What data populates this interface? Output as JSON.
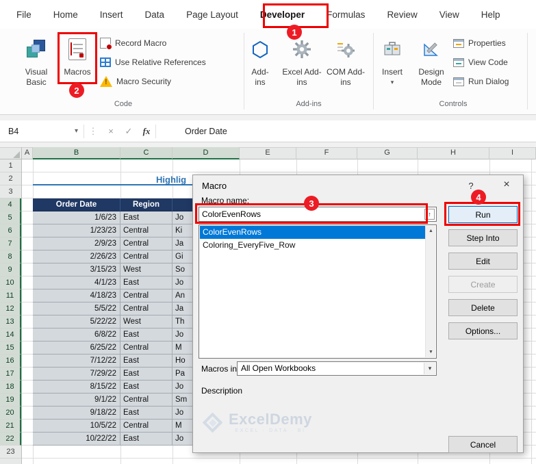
{
  "ribbon": {
    "tabs": [
      "File",
      "Home",
      "Insert",
      "Data",
      "Page Layout",
      "Developer",
      "Formulas",
      "Review",
      "View",
      "Help"
    ],
    "active_tab": "Developer",
    "code_group": {
      "label": "Code",
      "visual_basic": "Visual Basic",
      "macros": "Macros",
      "record_macro": "Record Macro",
      "use_relative_references": "Use Relative References",
      "macro_security": "Macro Security"
    },
    "addins_group": {
      "label": "Add-ins",
      "add_ins": "Add-ins",
      "excel_add_ins": "Excel Add-ins",
      "com_add_ins": "COM Add-ins"
    },
    "controls_group": {
      "label": "Controls",
      "insert": "Insert",
      "design_mode": "Design Mode",
      "properties": "Properties",
      "view_code": "View Code",
      "run_dialog": "Run Dialog"
    }
  },
  "formula_bar": {
    "name_box": "B4",
    "formula": "Order Date"
  },
  "annotations": {
    "step1": "1",
    "step2": "2",
    "step3": "3",
    "step4": "4"
  },
  "sheet": {
    "columns": [
      "A",
      "B",
      "C",
      "D",
      "E",
      "F",
      "G",
      "H",
      "I"
    ],
    "row_numbers": [
      "1",
      "2",
      "3",
      "4",
      "5",
      "6",
      "7",
      "8",
      "9",
      "10",
      "11",
      "12",
      "13",
      "14",
      "15",
      "16",
      "17",
      "18",
      "19",
      "20",
      "21",
      "22",
      "23"
    ],
    "title_visible": "Highlig",
    "table": {
      "header_order_date": "Order Date",
      "header_region": "Region",
      "rows": [
        {
          "date": "1/6/23",
          "region": "East",
          "person": "Jo"
        },
        {
          "date": "1/23/23",
          "region": "Central",
          "person": "Ki"
        },
        {
          "date": "2/9/23",
          "region": "Central",
          "person": "Ja"
        },
        {
          "date": "2/26/23",
          "region": "Central",
          "person": "Gi"
        },
        {
          "date": "3/15/23",
          "region": "West",
          "person": "So"
        },
        {
          "date": "4/1/23",
          "region": "East",
          "person": "Jo"
        },
        {
          "date": "4/18/23",
          "region": "Central",
          "person": "An"
        },
        {
          "date": "5/5/22",
          "region": "Central",
          "person": "Ja"
        },
        {
          "date": "5/22/22",
          "region": "West",
          "person": "Th"
        },
        {
          "date": "6/8/22",
          "region": "East",
          "person": "Jo"
        },
        {
          "date": "6/25/22",
          "region": "Central",
          "person": "M"
        },
        {
          "date": "7/12/22",
          "region": "East",
          "person": "Ho"
        },
        {
          "date": "7/29/22",
          "region": "East",
          "person": "Pa"
        },
        {
          "date": "8/15/22",
          "region": "East",
          "person": "Jo"
        },
        {
          "date": "9/1/22",
          "region": "Central",
          "person": "Sm"
        },
        {
          "date": "9/18/22",
          "region": "East",
          "person": "Jo"
        },
        {
          "date": "10/5/22",
          "region": "Central",
          "person": "M"
        },
        {
          "date": "10/22/22",
          "region": "East",
          "person": "Jo"
        }
      ]
    }
  },
  "dialog": {
    "title": "Macro",
    "macro_name_label": "Macro name:",
    "macro_name_value": "ColorEvenRows",
    "macro_list": [
      "ColorEvenRows",
      "Coloring_EveryFive_Row"
    ],
    "buttons": {
      "run": "Run",
      "step_into": "Step Into",
      "edit": "Edit",
      "create": "Create",
      "delete": "Delete",
      "options": "Options...",
      "cancel": "Cancel"
    },
    "macros_in_label": "Macros in:",
    "macros_in_value": "All Open Workbooks",
    "description_label": "Description"
  },
  "icons": {
    "name_box_dropdown": "▾",
    "vertical_ellipsis": "⋮",
    "cancel_x": "×",
    "enter_check": "✓",
    "function_fx": "fx",
    "insert_dropdown": "▾",
    "dialog_help": "?",
    "dialog_close": "×",
    "input_collapse": "↑",
    "scroll_up": "▲",
    "scroll_down": "▼",
    "combo_arrow": "▾",
    "warning_mark": "!"
  },
  "watermark": {
    "brand": "ExcelDemy",
    "tagline": "EXCEL · DATA · BI"
  },
  "colors": {
    "annotation_red": "#ee0000",
    "table_header_navy": "#1f3864",
    "selection_blue": "#0078d7",
    "title_blue": "#2e75b6",
    "tab_accent_green": "#1e7145"
  }
}
